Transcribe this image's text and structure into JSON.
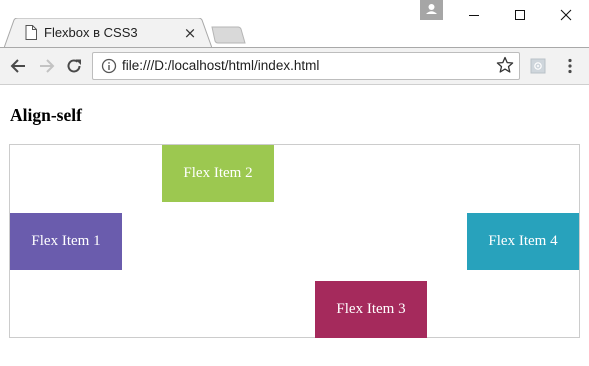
{
  "browser": {
    "tab_title": "Flexbox в CSS3",
    "tab_close_symbol": "×",
    "url": "file:///D:/localhost/html/index.html"
  },
  "page": {
    "heading": "Align-self",
    "items": [
      {
        "label": "Flex Item 1",
        "color": "#6a5cad"
      },
      {
        "label": "Flex Item 2",
        "color": "#9cc850"
      },
      {
        "label": "Flex Item 3",
        "color": "#a52a5c"
      },
      {
        "label": "Flex Item 4",
        "color": "#28a2bc"
      }
    ]
  },
  "colors": {
    "chrome_background": "#f2f2f2",
    "container_border": "#cccccc"
  }
}
